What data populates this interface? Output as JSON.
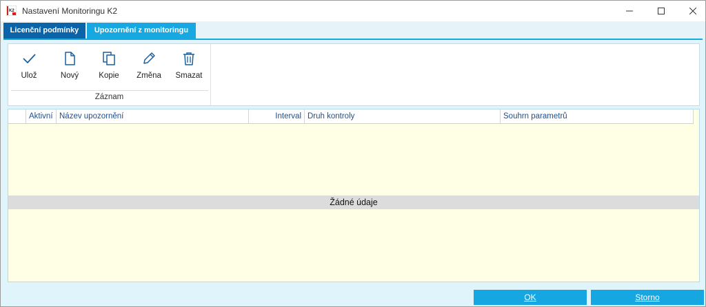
{
  "window": {
    "title": "Nastavení Monitoringu K2",
    "app_icon": "k2-app-icon",
    "controls": [
      "minimize-icon",
      "maximize-icon",
      "close-icon"
    ]
  },
  "tabs": [
    {
      "label": "Licenční podmínky",
      "active": false
    },
    {
      "label": "Upozornění z monitoringu",
      "active": true
    }
  ],
  "toolbar": {
    "buttons": [
      {
        "label": "Ulož",
        "icon": "check-icon"
      },
      {
        "label": "Nový",
        "icon": "new-document-icon"
      },
      {
        "label": "Kopie",
        "icon": "copy-icon"
      },
      {
        "label": "Změna",
        "icon": "pencil-icon"
      },
      {
        "label": "Smazat",
        "icon": "trash-icon"
      }
    ],
    "group_label": "Záznam"
  },
  "grid": {
    "columns": [
      "Aktivní",
      "Název upozornění",
      "Interval",
      "Druh kontroly",
      "Souhrn parametrů"
    ],
    "empty_text": "Žádné údaje"
  },
  "footer": {
    "ok_label": "OK",
    "storno_label": "Storno"
  },
  "colors": {
    "tab_inactive": "#0b63a8",
    "tab_active": "#17a8e2",
    "button": "#16a7e2",
    "grid_background": "#ffffe6",
    "header_text": "#1f4e8c"
  }
}
